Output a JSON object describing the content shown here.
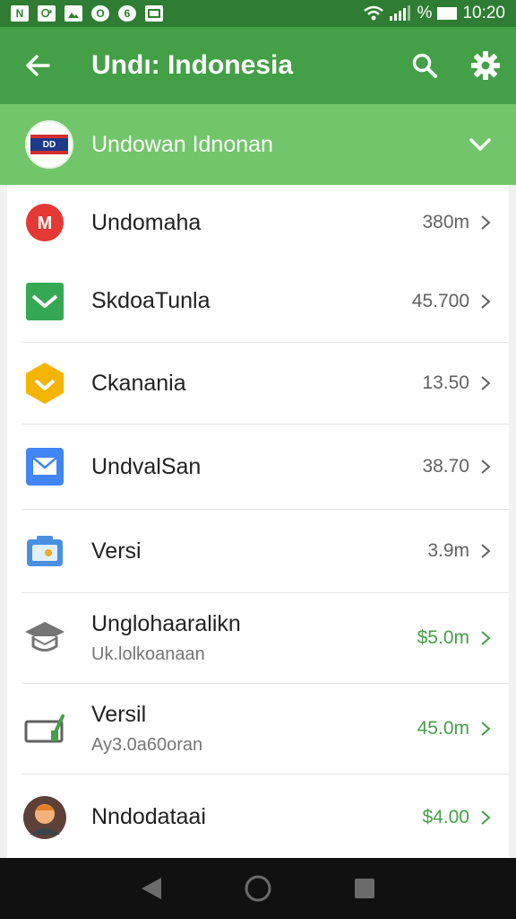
{
  "status_bar": {
    "icons": [
      "N",
      "Ꭴ",
      "",
      "O",
      "6",
      ""
    ],
    "percent_glyph": "%",
    "time": "10:20"
  },
  "app_bar": {
    "title": "Undı: Indonesia",
    "back_icon": "arrow-left-icon",
    "search_icon": "search-icon",
    "settings_icon": "gear-icon"
  },
  "section": {
    "title": "Undowan Idnonan",
    "avatar_text": "DD",
    "chevron_icon": "chevron-down-icon"
  },
  "list": {
    "items": [
      {
        "name": "Undomaha",
        "value": "380m",
        "icon": "red-m-icon",
        "green": false
      },
      {
        "name": "SkdoaTunla",
        "value": "45.700",
        "icon": "green-mail-icon",
        "green": false
      },
      {
        "name": "Ckanania",
        "value": "13.50",
        "icon": "yellow-hex-icon",
        "green": false
      },
      {
        "name": "UndvalSan",
        "value": "38.70",
        "icon": "blue-mail-icon",
        "green": false
      },
      {
        "name": "Versi",
        "value": "3.9m",
        "icon": "blue-camera-icon",
        "green": false
      },
      {
        "name": "Unglohaaralikn",
        "sub": "Uk.lolkoanaan",
        "value": "$5.0m",
        "icon": "graduation-cap-icon",
        "green": true
      },
      {
        "name": "Versil",
        "sub": "Ay3.0a60oran",
        "value": "45.0m",
        "icon": "edit-screen-icon",
        "green": true
      },
      {
        "name": "Nndodataai",
        "value": "$4.00",
        "icon": "person-avatar-icon",
        "green": true
      }
    ]
  },
  "colors": {
    "status_bar": "#2e7d32",
    "app_bar": "#43a047",
    "section": "#72c66a",
    "accent_green": "#43a047"
  }
}
